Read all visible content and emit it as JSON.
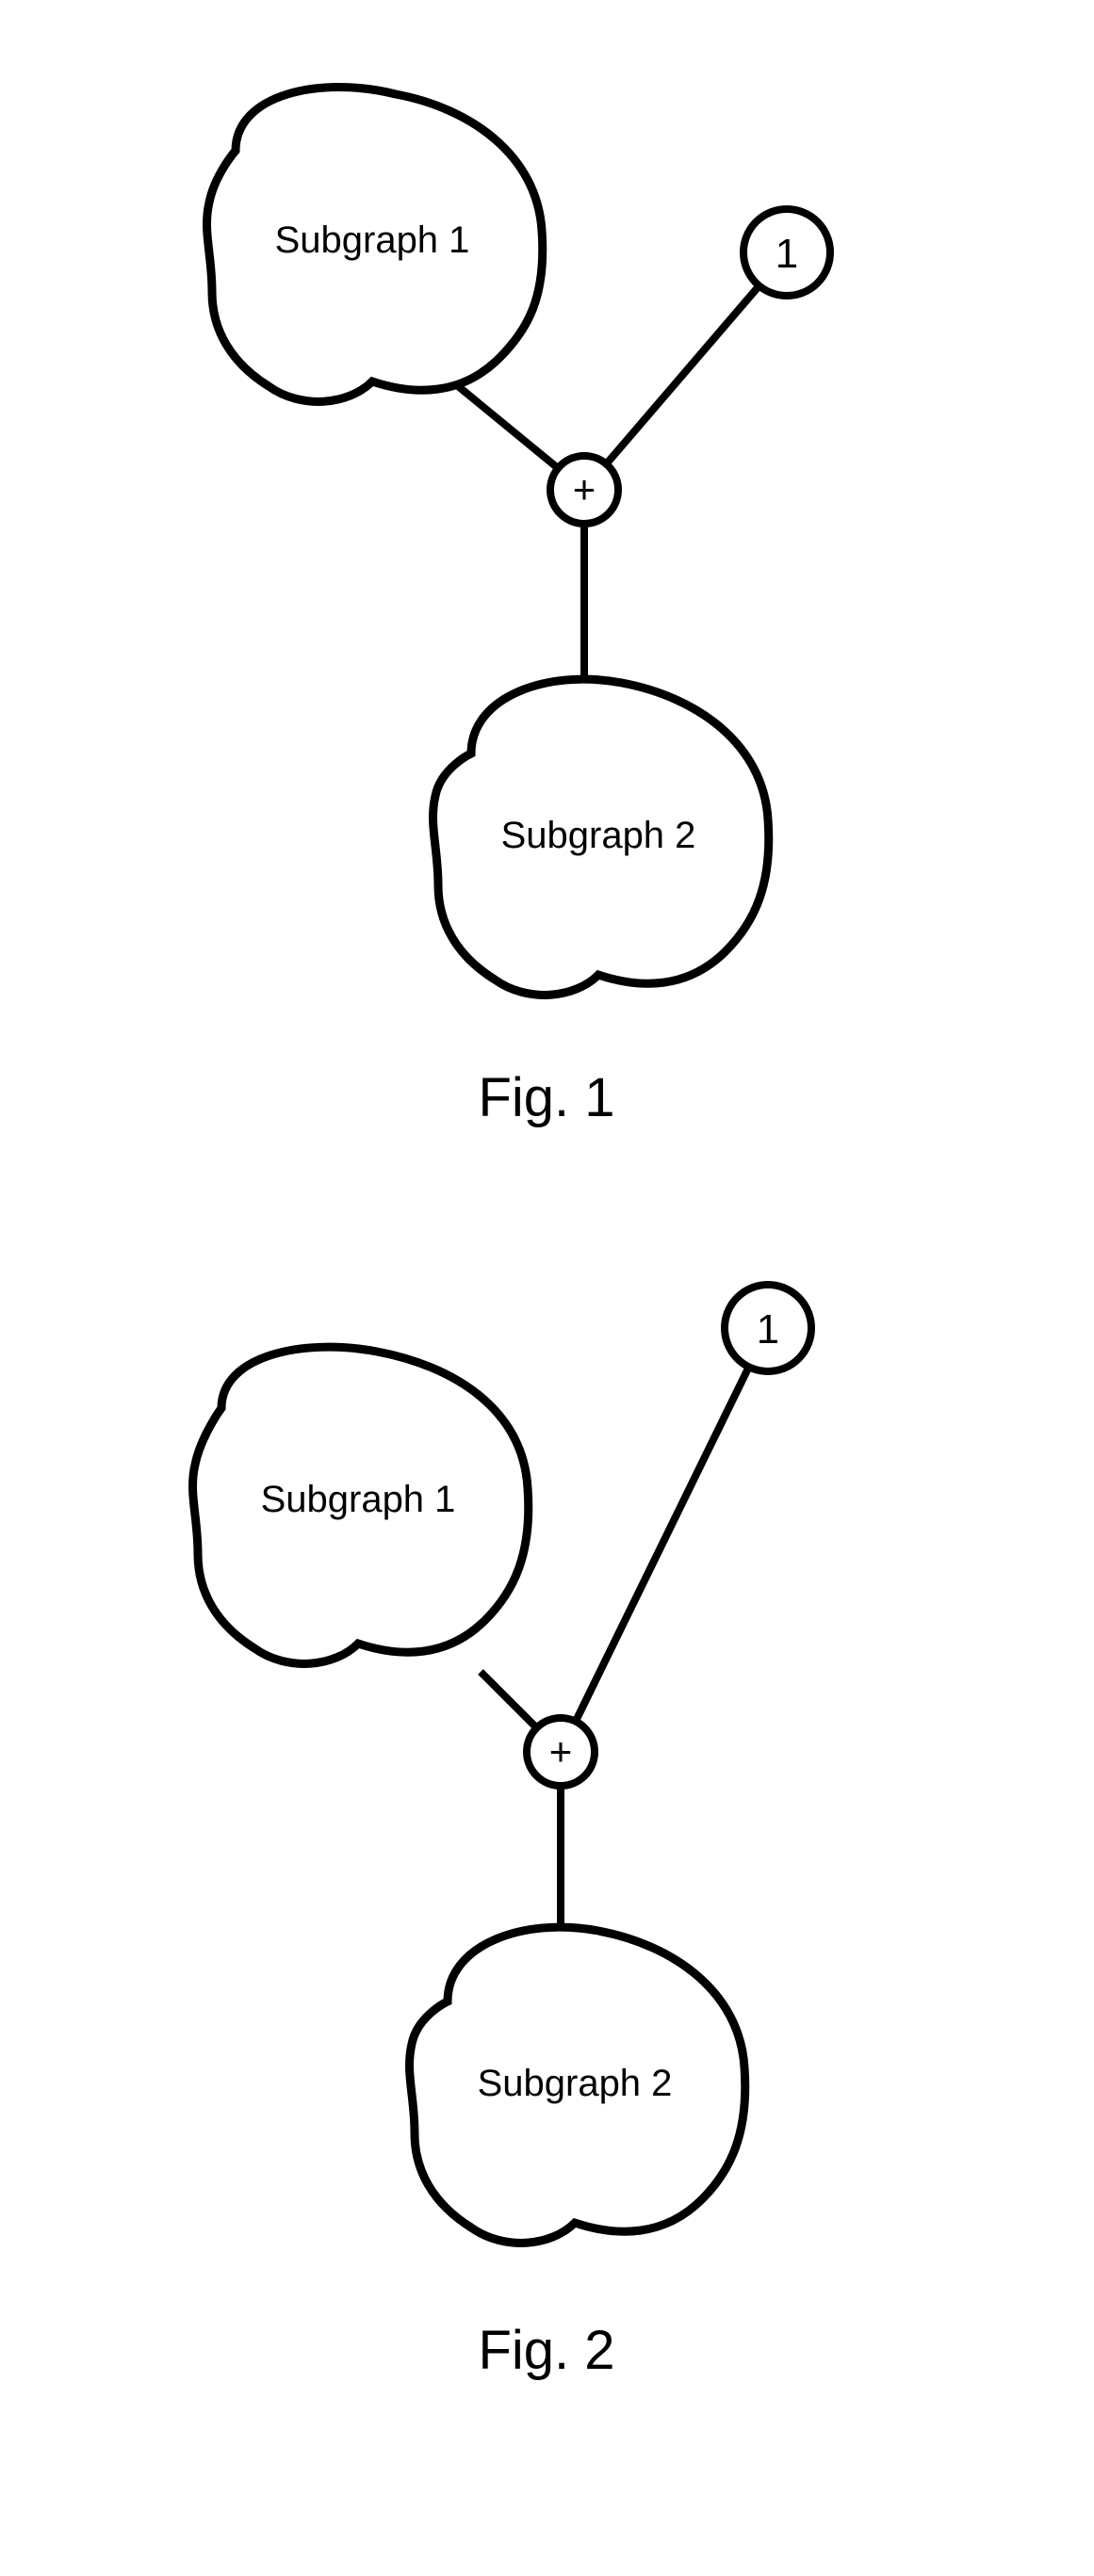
{
  "figures": [
    {
      "caption": "Fig. 1",
      "plus_label": "+",
      "one_label": "1",
      "subgraph1_label": "Subgraph 1",
      "subgraph2_label": "Subgraph 2"
    },
    {
      "caption": "Fig. 2",
      "plus_label": "+",
      "one_label": "1",
      "subgraph1_label": "Subgraph 1",
      "subgraph2_label": "Subgraph 2"
    }
  ]
}
